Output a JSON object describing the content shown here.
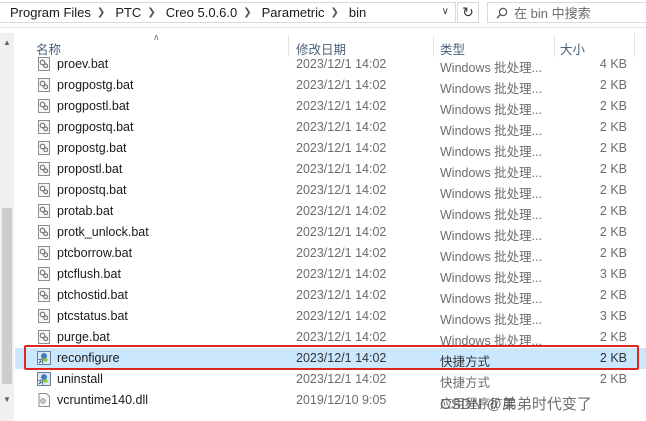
{
  "breadcrumb": [
    "Program Files",
    "PTC",
    "Creo 5.0.6.0",
    "Parametric",
    "bin"
  ],
  "search": {
    "placeholder": "在 bin 中搜索"
  },
  "columns": {
    "name": "名称",
    "date": "修改日期",
    "type": "类型",
    "size": "大小"
  },
  "files": [
    {
      "name": "proev.bat",
      "date": "2023/12/1 14:02",
      "type": "Windows 批处理...",
      "size": "4 KB",
      "icon": "bat-file-icon"
    },
    {
      "name": "progpostg.bat",
      "date": "2023/12/1 14:02",
      "type": "Windows 批处理...",
      "size": "2 KB",
      "icon": "bat-file-icon"
    },
    {
      "name": "progpostl.bat",
      "date": "2023/12/1 14:02",
      "type": "Windows 批处理...",
      "size": "2 KB",
      "icon": "bat-file-icon"
    },
    {
      "name": "progpostq.bat",
      "date": "2023/12/1 14:02",
      "type": "Windows 批处理...",
      "size": "2 KB",
      "icon": "bat-file-icon"
    },
    {
      "name": "propostg.bat",
      "date": "2023/12/1 14:02",
      "type": "Windows 批处理...",
      "size": "2 KB",
      "icon": "bat-file-icon"
    },
    {
      "name": "propostl.bat",
      "date": "2023/12/1 14:02",
      "type": "Windows 批处理...",
      "size": "2 KB",
      "icon": "bat-file-icon"
    },
    {
      "name": "propostq.bat",
      "date": "2023/12/1 14:02",
      "type": "Windows 批处理...",
      "size": "2 KB",
      "icon": "bat-file-icon"
    },
    {
      "name": "protab.bat",
      "date": "2023/12/1 14:02",
      "type": "Windows 批处理...",
      "size": "2 KB",
      "icon": "bat-file-icon"
    },
    {
      "name": "protk_unlock.bat",
      "date": "2023/12/1 14:02",
      "type": "Windows 批处理...",
      "size": "2 KB",
      "icon": "bat-file-icon"
    },
    {
      "name": "ptcborrow.bat",
      "date": "2023/12/1 14:02",
      "type": "Windows 批处理...",
      "size": "2 KB",
      "icon": "bat-file-icon"
    },
    {
      "name": "ptcflush.bat",
      "date": "2023/12/1 14:02",
      "type": "Windows 批处理...",
      "size": "3 KB",
      "icon": "bat-file-icon"
    },
    {
      "name": "ptchostid.bat",
      "date": "2023/12/1 14:02",
      "type": "Windows 批处理...",
      "size": "2 KB",
      "icon": "bat-file-icon"
    },
    {
      "name": "ptcstatus.bat",
      "date": "2023/12/1 14:02",
      "type": "Windows 批处理...",
      "size": "3 KB",
      "icon": "bat-file-icon"
    },
    {
      "name": "purge.bat",
      "date": "2023/12/1 14:02",
      "type": "Windows 批处理...",
      "size": "2 KB",
      "icon": "bat-file-icon"
    },
    {
      "name": "reconfigure",
      "date": "2023/12/1 14:02",
      "type": "快捷方式",
      "size": "2 KB",
      "icon": "shortcut-icon",
      "selected": true
    },
    {
      "name": "uninstall",
      "date": "2023/12/1 14:02",
      "type": "快捷方式",
      "size": "2 KB",
      "icon": "shortcut-icon"
    },
    {
      "name": "vcruntime140.dll",
      "date": "2019/12/10 9:05",
      "type": "应用程序扩展",
      "size": "",
      "icon": "dll-file-icon"
    }
  ],
  "watermark": "CSDN @弟弟时代变了",
  "colors": {
    "selection": "#cce8ff",
    "highlight_border": "#e0271f"
  }
}
